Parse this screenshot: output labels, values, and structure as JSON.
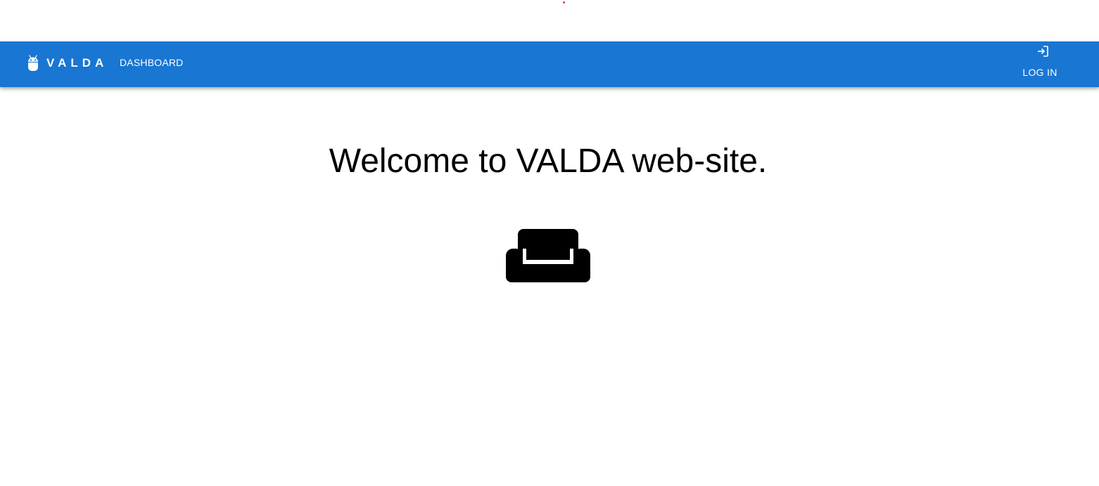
{
  "app": {
    "brand_name": "VALDA",
    "logo_icon": "android-robot-icon",
    "bar_color": "#1976d2"
  },
  "nav": {
    "dashboard_label": "DASHBOARD"
  },
  "auth": {
    "login_label": "LOG IN",
    "login_icon": "login-arrow-icon"
  },
  "main": {
    "welcome_text": "Welcome to VALDA web-site.",
    "hero_icon": "sofa-icon"
  }
}
